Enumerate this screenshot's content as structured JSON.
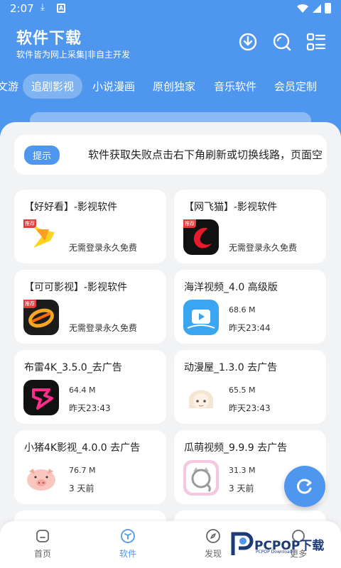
{
  "status": {
    "time": "2:07"
  },
  "header": {
    "title": "软件下载",
    "subtitle": "软件皆为网上采集|非自主开发"
  },
  "tabs": [
    "文游",
    "追剧影视",
    "小说漫画",
    "原创独家",
    "音乐软件",
    "会员定制"
  ],
  "notice": {
    "tip": "提示",
    "text": "软件获取失败点击右下角刷新或切换线路，页面空"
  },
  "cards": [
    {
      "title": "【好好看】-影视软件",
      "tag": "推荐",
      "desc": "无需登录永久免费",
      "icon": "haohaokan-app-icon"
    },
    {
      "title": "【网飞猫】-影视软件",
      "tag": "推荐",
      "desc": "无需登录永久免费",
      "icon": "wangfeimao-app-icon"
    },
    {
      "title": "【可可影视】-影视软件",
      "tag": "推荐",
      "desc": "无需登录永久免费",
      "icon": "keke-app-icon"
    },
    {
      "title": "海洋视频_4.0 高级版",
      "size": "68.6 M",
      "date": "昨天23:44",
      "icon": "haiyang-app-icon"
    },
    {
      "title": "布雷4K_3.5.0_去广告",
      "size": "64.4 M",
      "date": "昨天23:43",
      "icon": "bulei-app-icon"
    },
    {
      "title": "动漫屋_1.3.0 去广告",
      "size": "65.5 M",
      "date": "昨天23:43",
      "icon": "dongmanwu-app-icon"
    },
    {
      "title": "小猪4K影视_4.0.0 去广告",
      "size": "76.7 M",
      "date": "3 天前",
      "icon": "pig-app-icon"
    },
    {
      "title": "瓜萌视频_9.9.9 去广告",
      "size": "31.3 M",
      "date": "3 天前",
      "icon": "cat-app-icon"
    }
  ],
  "nav": [
    {
      "label": "首页",
      "icon": "home-icon"
    },
    {
      "label": "软件",
      "icon": "cube-icon"
    },
    {
      "label": "发现",
      "icon": "compass-icon"
    },
    {
      "label": "更多",
      "icon": "more-icon"
    }
  ],
  "watermark": {
    "text": "PCPOP下载",
    "sub": "PCPOP Download"
  },
  "colors": {
    "primary": "#4f96ee",
    "tag": "#e73c3c"
  }
}
